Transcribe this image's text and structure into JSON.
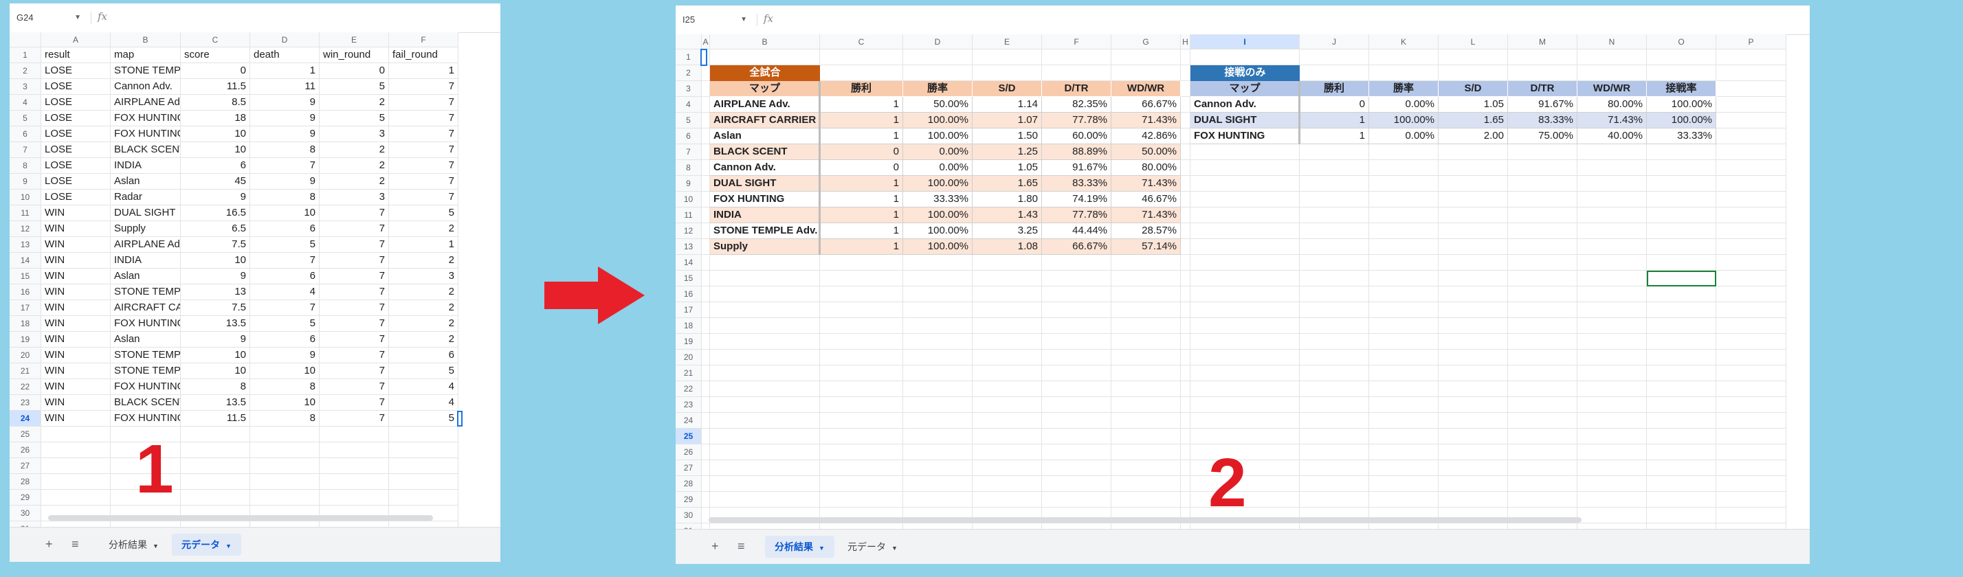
{
  "sheet1": {
    "namebox": "G24",
    "fx": "fx",
    "columns": [
      "A",
      "B",
      "C",
      "D",
      "E",
      "F"
    ],
    "selected_row": 24,
    "row_count": 31,
    "rows": [
      [
        "result",
        "map",
        "score",
        "death",
        "win_round",
        "fail_round"
      ],
      [
        "LOSE",
        "STONE TEMPLE Adv.",
        "0",
        "1",
        "0",
        "1"
      ],
      [
        "LOSE",
        "Cannon Adv.",
        "11.5",
        "11",
        "5",
        "7"
      ],
      [
        "LOSE",
        "AIRPLANE Adv.",
        "8.5",
        "9",
        "2",
        "7"
      ],
      [
        "LOSE",
        "FOX HUNTING",
        "18",
        "9",
        "5",
        "7"
      ],
      [
        "LOSE",
        "FOX HUNTING",
        "10",
        "9",
        "3",
        "7"
      ],
      [
        "LOSE",
        "BLACK SCENT",
        "10",
        "8",
        "2",
        "7"
      ],
      [
        "LOSE",
        "INDIA",
        "6",
        "7",
        "2",
        "7"
      ],
      [
        "LOSE",
        "Aslan",
        "45",
        "9",
        "2",
        "7"
      ],
      [
        "LOSE",
        "Radar",
        "9",
        "8",
        "3",
        "7"
      ],
      [
        "WIN",
        "DUAL SIGHT",
        "16.5",
        "10",
        "7",
        "5"
      ],
      [
        "WIN",
        "Supply",
        "6.5",
        "6",
        "7",
        "2"
      ],
      [
        "WIN",
        "AIRPLANE Adv.",
        "7.5",
        "5",
        "7",
        "1"
      ],
      [
        "WIN",
        "INDIA",
        "10",
        "7",
        "7",
        "2"
      ],
      [
        "WIN",
        "Aslan",
        "9",
        "6",
        "7",
        "3"
      ],
      [
        "WIN",
        "STONE TEMPLE Adv.",
        "13",
        "4",
        "7",
        "2"
      ],
      [
        "WIN",
        "AIRCRAFT CARRIER",
        "7.5",
        "7",
        "7",
        "2"
      ],
      [
        "WIN",
        "FOX HUNTING",
        "13.5",
        "5",
        "7",
        "2"
      ],
      [
        "WIN",
        "Aslan",
        "9",
        "6",
        "7",
        "2"
      ],
      [
        "WIN",
        "STONE TEMPLE Adv.",
        "10",
        "9",
        "7",
        "6"
      ],
      [
        "WIN",
        "STONE TEMPLE Adv.",
        "10",
        "10",
        "7",
        "5"
      ],
      [
        "WIN",
        "FOX HUNTING",
        "8",
        "8",
        "7",
        "4"
      ],
      [
        "WIN",
        "BLACK SCENT",
        "13.5",
        "10",
        "7",
        "4"
      ],
      [
        "WIN",
        "FOX HUNTING",
        "11.5",
        "8",
        "7",
        "5"
      ]
    ],
    "tabs": [
      {
        "label": "分析結果",
        "active": false
      },
      {
        "label": "元データ",
        "active": true
      }
    ],
    "overlay_number": "1"
  },
  "arrow_color": "#e8202a",
  "sheet2": {
    "namebox": "I25",
    "fx": "fx",
    "columns": [
      "A",
      "B",
      "C",
      "D",
      "E",
      "F",
      "G",
      "H",
      "I",
      "J",
      "K",
      "L",
      "M",
      "N",
      "O",
      "P"
    ],
    "selected_col": "I",
    "selected_row": 25,
    "row_count": 32,
    "all_table": {
      "title": "全試合",
      "title_color": "#c55a11",
      "header_color": "#f8cbad",
      "row_color": "#fce4d6",
      "headers": [
        "マップ",
        "勝利",
        "勝率",
        "S/D",
        "D/TR",
        "WD/WR"
      ],
      "rows": [
        [
          "AIRPLANE Adv.",
          "1",
          "50.00%",
          "1.14",
          "82.35%",
          "66.67%"
        ],
        [
          "AIRCRAFT CARRIER",
          "1",
          "100.00%",
          "1.07",
          "77.78%",
          "71.43%"
        ],
        [
          "Aslan",
          "1",
          "100.00%",
          "1.50",
          "60.00%",
          "42.86%"
        ],
        [
          "BLACK SCENT",
          "0",
          "0.00%",
          "1.25",
          "88.89%",
          "50.00%"
        ],
        [
          "Cannon Adv.",
          "0",
          "0.00%",
          "1.05",
          "91.67%",
          "80.00%"
        ],
        [
          "DUAL SIGHT",
          "1",
          "100.00%",
          "1.65",
          "83.33%",
          "71.43%"
        ],
        [
          "FOX HUNTING",
          "1",
          "33.33%",
          "1.80",
          "74.19%",
          "46.67%"
        ],
        [
          "INDIA",
          "1",
          "100.00%",
          "1.43",
          "77.78%",
          "71.43%"
        ],
        [
          "STONE TEMPLE Adv.",
          "1",
          "100.00%",
          "3.25",
          "44.44%",
          "28.57%"
        ],
        [
          "Supply",
          "1",
          "100.00%",
          "1.08",
          "66.67%",
          "57.14%"
        ]
      ]
    },
    "close_table": {
      "title": "接戦のみ",
      "title_color": "#2e75b6",
      "header_color": "#b4c6e7",
      "row_color": "#d9e1f2",
      "headers": [
        "マップ",
        "勝利",
        "勝率",
        "S/D",
        "D/TR",
        "WD/WR",
        "接戦率"
      ],
      "rows": [
        [
          "Cannon Adv.",
          "0",
          "0.00%",
          "1.05",
          "91.67%",
          "80.00%",
          "100.00%"
        ],
        [
          "DUAL SIGHT",
          "1",
          "100.00%",
          "1.65",
          "83.33%",
          "71.43%",
          "100.00%"
        ],
        [
          "FOX HUNTING",
          "1",
          "0.00%",
          "2.00",
          "75.00%",
          "40.00%",
          "33.33%"
        ]
      ]
    },
    "tabs": [
      {
        "label": "分析結果",
        "active": true
      },
      {
        "label": "元データ",
        "active": false
      }
    ],
    "overlay_number": "2"
  }
}
